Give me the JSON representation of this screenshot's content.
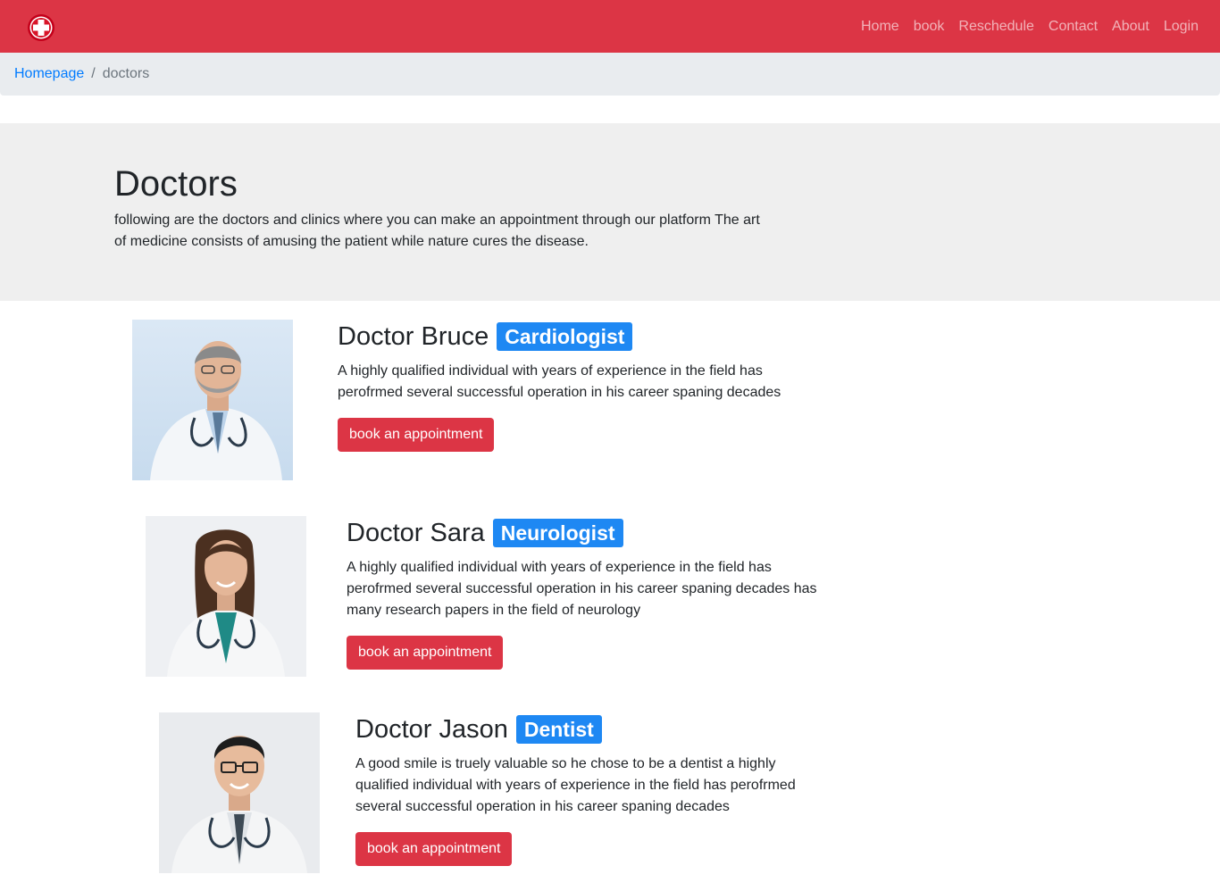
{
  "nav": {
    "items": [
      "Home",
      "book",
      "Reschedule",
      "Contact",
      "About",
      "Login"
    ]
  },
  "breadcrumb": {
    "home": "Homepage",
    "separator": "/",
    "current": "doctors"
  },
  "hero": {
    "title": "Doctors",
    "text": "following are the doctors and clinics where you can make an appointment through our platform The art of medicine consists of amusing the patient while nature cures the disease."
  },
  "doctors": [
    {
      "name": "Doctor Bruce",
      "specialty": "Cardiologist",
      "description": "A highly qualified individual with years of experience in the field has perofrmed several successful operation in his career spaning decades",
      "button": "book an appointment"
    },
    {
      "name": "Doctor Sara",
      "specialty": "Neurologist",
      "description": "A highly qualified individual with years of experience in the field has perofrmed several successful operation in his career spaning decades has many research papers in the field of neurology",
      "button": "book an appointment"
    },
    {
      "name": "Doctor Jason",
      "specialty": "Dentist",
      "description": "A good smile is truely valuable so he chose to be a dentist a highly qualified individual with years of experience in the field has perofrmed several successful operation in his career spaning decades",
      "button": "book an appointment"
    }
  ],
  "colors": {
    "navbar": "#dc3545",
    "badge": "#1e88f3",
    "button": "#dc3545",
    "jumbotron": "#efefef",
    "link": "#007bff"
  },
  "icons": {
    "brand": "medical-cross-icon"
  }
}
